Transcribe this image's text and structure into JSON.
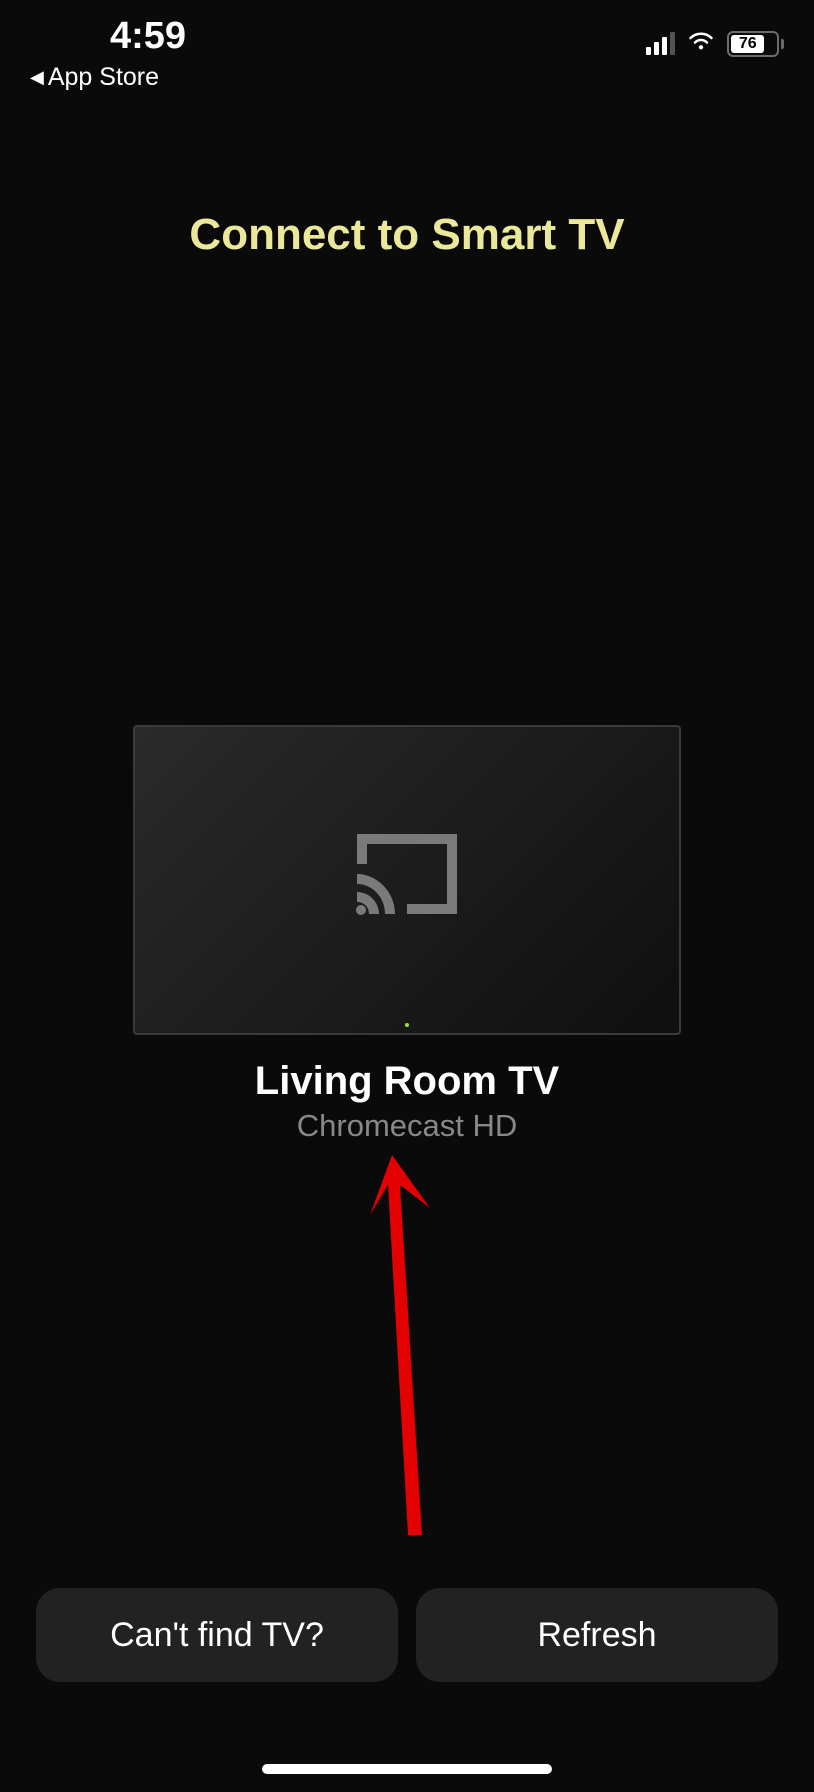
{
  "status_bar": {
    "time": "4:59",
    "back_label": "App Store",
    "battery_percent": "76"
  },
  "page": {
    "title": "Connect to Smart TV"
  },
  "device": {
    "name": "Living Room TV",
    "type": "Chromecast HD"
  },
  "buttons": {
    "cant_find": "Can't find TV?",
    "refresh": "Refresh"
  }
}
